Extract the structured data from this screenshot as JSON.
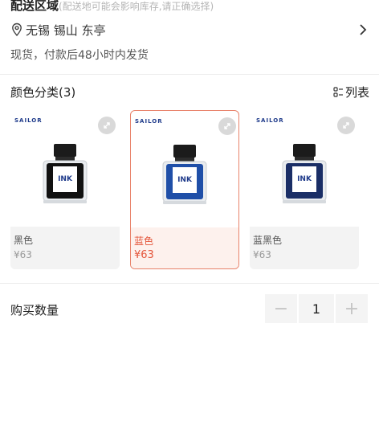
{
  "delivery": {
    "title": "配送区域",
    "note": "(配送地可能会影响库存,请正确选择)",
    "location": "无锡 锡山 东亭",
    "ship_note": "现货，付款后48小时内发货"
  },
  "variants": {
    "section_title": "颜色分类(3)",
    "list_label": "列表",
    "items": [
      {
        "brand": "SAILOR",
        "name": "黑色",
        "price": "¥63",
        "bottle_label": "INK",
        "ink_color": "#111111"
      },
      {
        "brand": "SAILOR",
        "name": "蓝色",
        "price": "¥63",
        "bottle_label": "INK",
        "ink_color": "#1f4fa8"
      },
      {
        "brand": "SAILOR",
        "name": "蓝黑色",
        "price": "¥63",
        "bottle_label": "INK",
        "ink_color": "#1a2e66"
      }
    ],
    "selected_index": 1
  },
  "quantity": {
    "label": "购买数量",
    "value": "1",
    "minus": "−",
    "plus": "+"
  },
  "colors": {
    "accent": "#e4553a",
    "selected_border": "#e8826a",
    "brand_navy": "#1e3a8a"
  }
}
